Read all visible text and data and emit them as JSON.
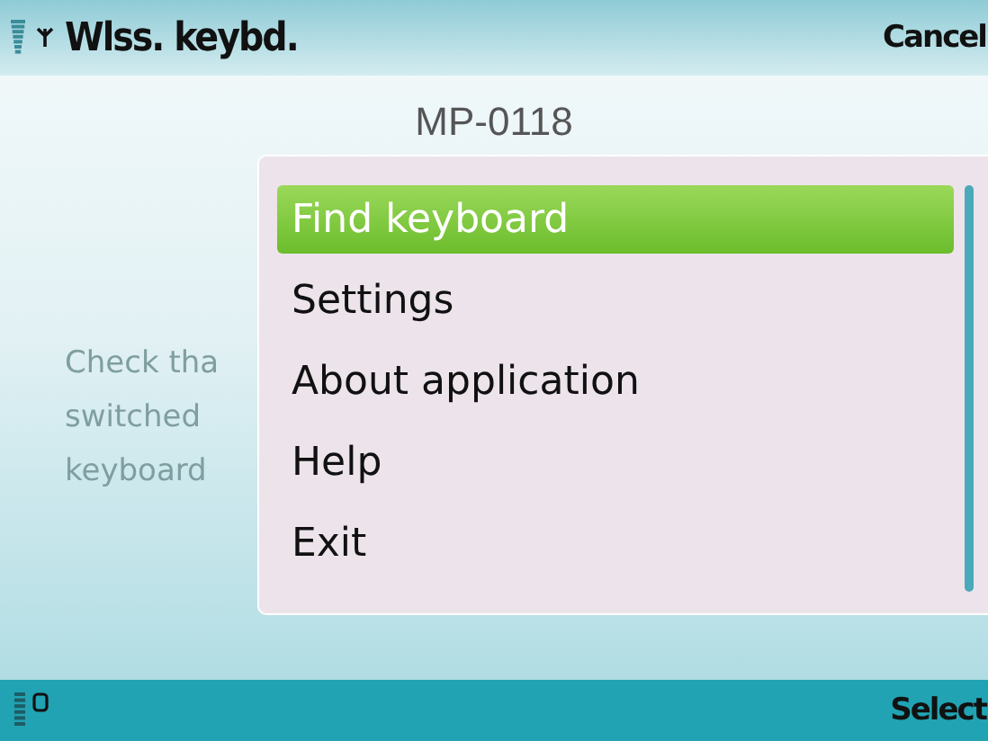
{
  "status_bar": {
    "title": "Wlss. keybd.",
    "right_softkey": "Cancel"
  },
  "heading": "MP-0118",
  "body_lines": [
    "Check tha",
    "switched",
    "keyboard"
  ],
  "menu": {
    "items": [
      {
        "label": "Find keyboard",
        "selected": true
      },
      {
        "label": "Settings",
        "selected": false
      },
      {
        "label": "About application",
        "selected": false
      },
      {
        "label": "Help",
        "selected": false
      },
      {
        "label": "Exit",
        "selected": false
      }
    ]
  },
  "softkeys": {
    "right": "Select"
  }
}
